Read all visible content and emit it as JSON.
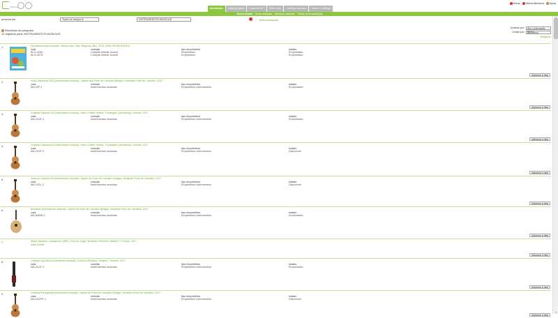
{
  "header": {
    "logo_text": "Biblioteca",
    "tabs": [
      "Introdução",
      "Catálogo geral",
      "Conta de MFI",
      "Sítios Web",
      "Catálogo colectivo",
      "Sobre o Catálogo"
    ],
    "active_tab": 0,
    "user_links": [
      "Entrar",
      "Minha biblioteca",
      "Ajuda"
    ]
  },
  "subnav": {
    "items": [
      "Busca simples",
      "Busca avançada",
      "Busca por categoria",
      "Últimas novas aquisições"
    ]
  },
  "search": {
    "label": "procurar por",
    "field_select": "Todos os campos",
    "query": "INSTRUMENTOS MUSICAIS",
    "advanced_link": "Busca avançada"
  },
  "results_head": {
    "line1": "Resultado da pesquisa",
    "line2": "10 registros para: INSTRUMENTOS MUSICAIS"
  },
  "sort": {
    "order_label": "Ordenar por:",
    "order_value": "Ano (ordenação desc)",
    "limit_label": "Limitar por:",
    "limit_value": "Biblioteca",
    "records_link": "Registros"
  },
  "colheads": {
    "cota": "cota",
    "colecao": "coleção",
    "tipo": "tipo empréstimo",
    "estado": "estado"
  },
  "add_label": "Adicionar à lista",
  "records": [
    {
      "num": "1.",
      "title": "Os instrumentos musicais / Maria Lobo; illus. Ahlgreas, Alex, 2015, ISBN 978-85-92425-6",
      "rows": [
        [
          "IB-D-4030",
          "Coleção Infantil Juvenil",
          "Empréstimo",
          "Emprestado"
        ],
        [
          "IB-D-4076",
          "Coleção Infantil Juvenil",
          "Empréstimo",
          "Emprestado"
        ]
      ],
      "thumb": "book"
    },
    {
      "num": "2.",
      "title": "Viola Caipirinha 2013 [instrumento musical] / Jardim dos Porto de Carvalho (Braga) / Amândio Porto de Carvalho, 2017",
      "rows": [
        [
          "MA-VIP-1",
          "Instrumentos musicais",
          "Empréstimo instrumentos",
          "Emprestado"
        ]
      ],
      "thumb": "guitar"
    },
    {
      "num": "3.",
      "title": "Guitarra Clássica 3/4 [Instrumento musical] / Hans Crafter Hohner, Trossingen (Alemanha) / Hohner, 2017",
      "rows": [
        [
          "MA-GUIT-1",
          "Instrumentos musicais",
          "Empréstimo instrumentos",
          "Emprestado"
        ]
      ],
      "thumb": "guitar"
    },
    {
      "num": "4.",
      "title": "Guitarra Clássica 4/4 [Instrumento musical] / Hans Crafter Hohner, Trossingen (Alemanha) / Hohner, 2017",
      "rows": [
        [
          "MA-GUIT-2",
          "Instrumentos musicais",
          "Empréstimo instrumentos",
          "Disponível"
        ]
      ],
      "thumb": "guitar"
    },
    {
      "num": "5.",
      "title": "Viola de Coimbra 3/4 [instrumento musical] / Jardim de Porto de Carvalho (Braga) / Amândio Porto de Carvalho, 2017",
      "rows": [
        [
          "MA-VIOL-2",
          "Instrumentos musicais",
          "Empréstimo instrumentos",
          "Disponível"
        ]
      ],
      "thumb": "guitar"
    },
    {
      "num": "6.",
      "title": "Bandolim [instrumento musical] / Jardim de Porto de Carvalho (Braga) / Amândio Porto de Carvalho, 2017",
      "rows": [
        [
          "MA-BAND-1",
          "Instrumentos musicais",
          "Empréstimo instrumentos",
          "Emprestado"
        ]
      ],
      "thumb": "mandolin"
    },
    {
      "num": "7.",
      "title": "Afinar Bandola, Cavaquinho [JRE] / solo do Jorge / Amândio Pinhoeiro (Brasil), TV Globo, 2017",
      "rows": [],
      "extra": "www.Cenda",
      "thumb": "none"
    },
    {
      "num": "8.",
      "title": "Guitarra Lap Steel [instrumento musical] / Gretsch (Portland, Oregon) / Gretsch, 2017",
      "rows": [
        [
          "MA-GUIT-1",
          "Instrumentos musicais",
          "Empréstimo instrumentos",
          "Emprestado"
        ]
      ],
      "thumb": "lapsteel"
    },
    {
      "num": "9.",
      "title": "Guitarra Portuguesa [instrumento musical] / Jardim de Porto de Carvalho (Braga) / Amândio Porto de Carvalho, 2017",
      "rows": [
        [
          "MA-GUITP-1",
          "Instrumentos musicais",
          "Empréstimo instrumentos",
          "Disponível"
        ]
      ],
      "thumb": "guitar"
    }
  ],
  "colors": {
    "accent": "#8dc63f",
    "link": "#6ea830",
    "tab_inactive": "#b9b9b9"
  }
}
